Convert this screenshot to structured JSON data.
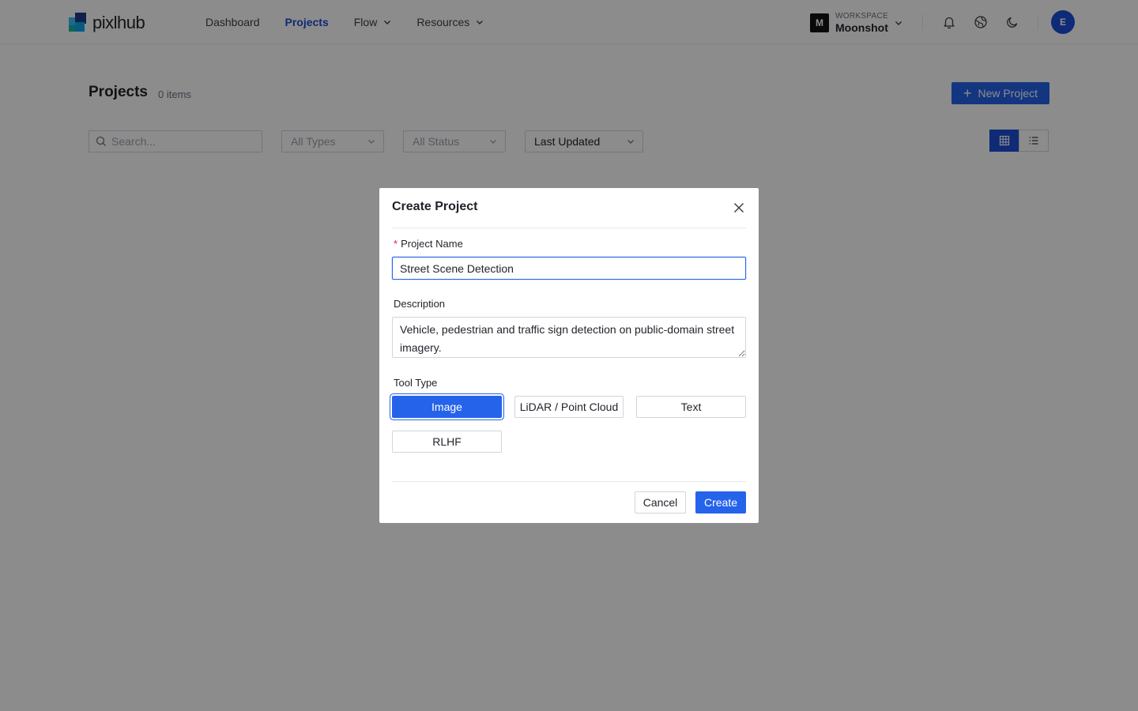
{
  "header": {
    "logo_text": "pixlhub",
    "nav": [
      {
        "label": "Dashboard",
        "active": false,
        "dropdown": false
      },
      {
        "label": "Projects",
        "active": true,
        "dropdown": false
      },
      {
        "label": "Flow",
        "active": false,
        "dropdown": true
      },
      {
        "label": "Resources",
        "active": false,
        "dropdown": true
      }
    ],
    "workspace": {
      "badge": "M",
      "caption": "WORKSPACE",
      "name": "Moonshot"
    },
    "icons": [
      "bell-icon",
      "globe-icon",
      "moon-icon"
    ],
    "avatar_initial": "E"
  },
  "page": {
    "title": "Projects",
    "count": "0 items",
    "new_button": "New Project",
    "search_placeholder": "Search...",
    "filters": [
      {
        "label": "All Types"
      },
      {
        "label": "All Status"
      },
      {
        "label": "Last Updated"
      }
    ],
    "view_modes": [
      "grid",
      "list"
    ],
    "active_view": "grid"
  },
  "modal": {
    "title": "Create Project",
    "name_label": "Project Name",
    "name_value": "Street Scene Detection",
    "desc_label": "Description",
    "desc_value": "Vehicle, pedestrian and traffic sign detection on public-domain street imagery.",
    "tool_label": "Tool Type",
    "tools": [
      {
        "label": "Image",
        "selected": true
      },
      {
        "label": "LiDAR / Point Cloud",
        "selected": false
      },
      {
        "label": "Text",
        "selected": false
      },
      {
        "label": "RLHF",
        "selected": false
      }
    ],
    "cancel": "Cancel",
    "create": "Create"
  },
  "colors": {
    "accent": "#2563eb",
    "accent_dark": "#1d4ed8",
    "required": "#e11d48"
  }
}
